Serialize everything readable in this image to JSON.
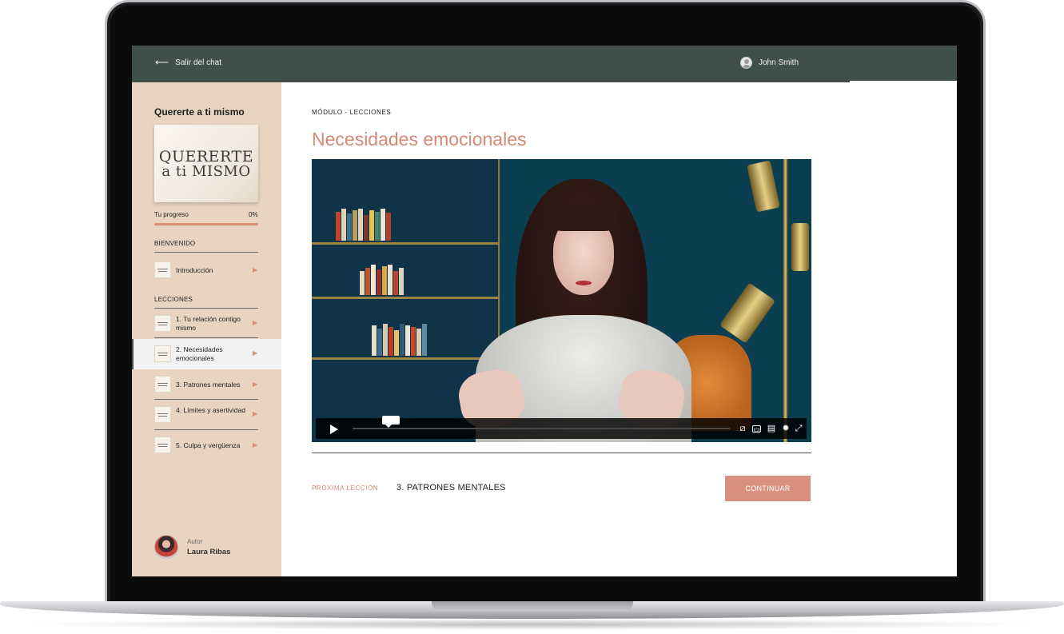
{
  "topbar": {
    "back_label": "Salir del chat",
    "user_name": "John Smith"
  },
  "sidebar": {
    "course_title": "Quererte a ti mismo",
    "cover": {
      "line1": "QUERERTE",
      "line2": "a ti MISMO"
    },
    "progress": {
      "label": "Tu progreso",
      "percent_text": "0%",
      "value": 0
    },
    "sections": [
      {
        "heading": "BIENVENIDO",
        "lessons": [
          {
            "label": "Introducción",
            "active": false
          }
        ]
      },
      {
        "heading": "LECCIONES",
        "lessons": [
          {
            "label": "1. Tu relación contigo mismo",
            "active": false
          },
          {
            "label": "2. Necesidades emocionales",
            "active": true
          },
          {
            "label": "3. Patrones mentales",
            "active": false
          },
          {
            "label": "4. Límites y asertividad",
            "active": false
          },
          {
            "label": "5. Culpa y vergüenza",
            "active": false
          }
        ]
      }
    ],
    "author": {
      "label": "Autor",
      "name": "Laura Ribas"
    }
  },
  "main": {
    "breadcrumb": "MÓDULO - LECCIONES",
    "title": "Necesidades emocionales",
    "next": {
      "label": "PRÓXIMA LECCIÓN",
      "title": "3. PATRONES MENTALES",
      "button": "CONTINUAR"
    }
  },
  "colors": {
    "topbar": "#3f504b",
    "sidebar": "#e8d4c0",
    "accent": "#d08a75",
    "button": "#d9907c"
  },
  "icons": [
    "arrow-left-icon",
    "user-avatar-icon",
    "play-icon",
    "volume-icon",
    "captions-icon",
    "playlist-icon",
    "settings-icon",
    "fullscreen-icon"
  ]
}
